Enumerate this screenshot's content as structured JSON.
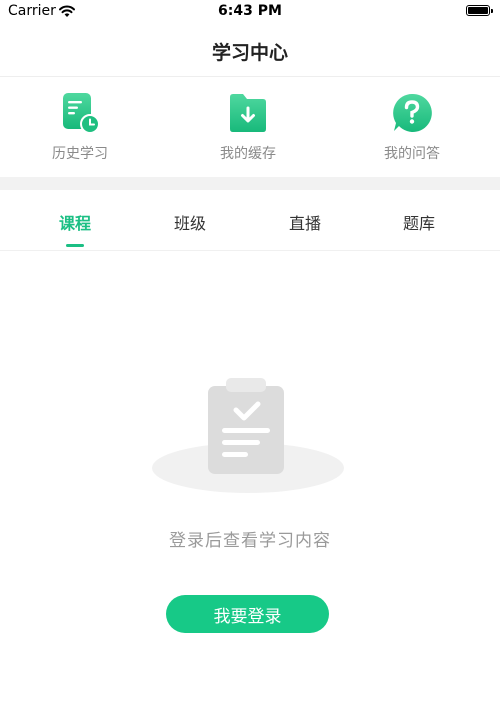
{
  "status_bar": {
    "carrier": "Carrier",
    "time": "6:43 PM"
  },
  "header": {
    "title": "学习中心"
  },
  "shortcuts": [
    {
      "label": "历史学习",
      "icon": "history-doc-clock-icon"
    },
    {
      "label": "我的缓存",
      "icon": "folder-download-icon"
    },
    {
      "label": "我的问答",
      "icon": "question-bubble-icon"
    }
  ],
  "tabs": [
    {
      "label": "课程",
      "active": true
    },
    {
      "label": "班级",
      "active": false
    },
    {
      "label": "直播",
      "active": false
    },
    {
      "label": "题库",
      "active": false
    }
  ],
  "empty_state": {
    "icon": "empty-clipboard-icon",
    "message": "登录后查看学习内容",
    "login_button": "我要登录"
  },
  "colors": {
    "accent": "#1bbf84",
    "button": "#17c987",
    "muted_text": "#9a9a9a",
    "divider": "#f2f2f2"
  }
}
